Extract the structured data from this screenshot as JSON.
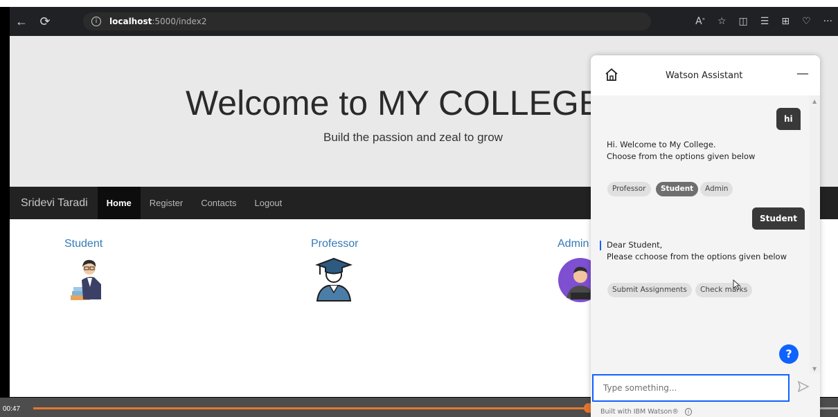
{
  "browser": {
    "url_host": "localhost",
    "url_path": ":5000/index2",
    "icons": [
      "back-arrow-icon",
      "refresh-icon",
      "info-icon",
      "read-aloud-icon",
      "favorite-star-icon",
      "split-screen-icon",
      "favorites-icon",
      "collections-icon",
      "browser-essentials-icon",
      "more-icon"
    ]
  },
  "hero": {
    "title": "Welcome to MY COLLEGE",
    "subtitle": "Build the passion and zeal to grow"
  },
  "navbar": {
    "brand": "Sridevi Taradi",
    "items": [
      {
        "label": "Home",
        "active": true
      },
      {
        "label": "Register",
        "active": false
      },
      {
        "label": "Contacts",
        "active": false
      },
      {
        "label": "Logout",
        "active": false
      }
    ]
  },
  "roles": [
    {
      "label": "Student"
    },
    {
      "label": "Professor"
    },
    {
      "label": "Admin"
    }
  ],
  "video": {
    "timecode": "00:47",
    "progress_fraction": 0.69
  },
  "watson": {
    "title": "Watson Assistant",
    "messages": {
      "user1": "hi",
      "bot1_line1": "Hi. Welcome to My College.",
      "bot1_line2": "Choose from the options given below",
      "options1": [
        {
          "label": "Professor",
          "selected": false
        },
        {
          "label": "Student",
          "selected": true
        },
        {
          "label": "Admin",
          "selected": false
        }
      ],
      "user2": "Student",
      "bot2_line1": "Dear Student,",
      "bot2_line2": "Please cchoose from the options given below",
      "options2": [
        {
          "label": "Submit Assignments",
          "selected": false
        },
        {
          "label": "Check marks",
          "selected": false
        }
      ]
    },
    "help_label": "?",
    "input_placeholder": "Type something...",
    "footer": "Built with IBM Watson®"
  },
  "colors": {
    "accent_blue": "#0f62fe",
    "progress_orange": "#e8762b",
    "link_blue": "#337ab7"
  }
}
